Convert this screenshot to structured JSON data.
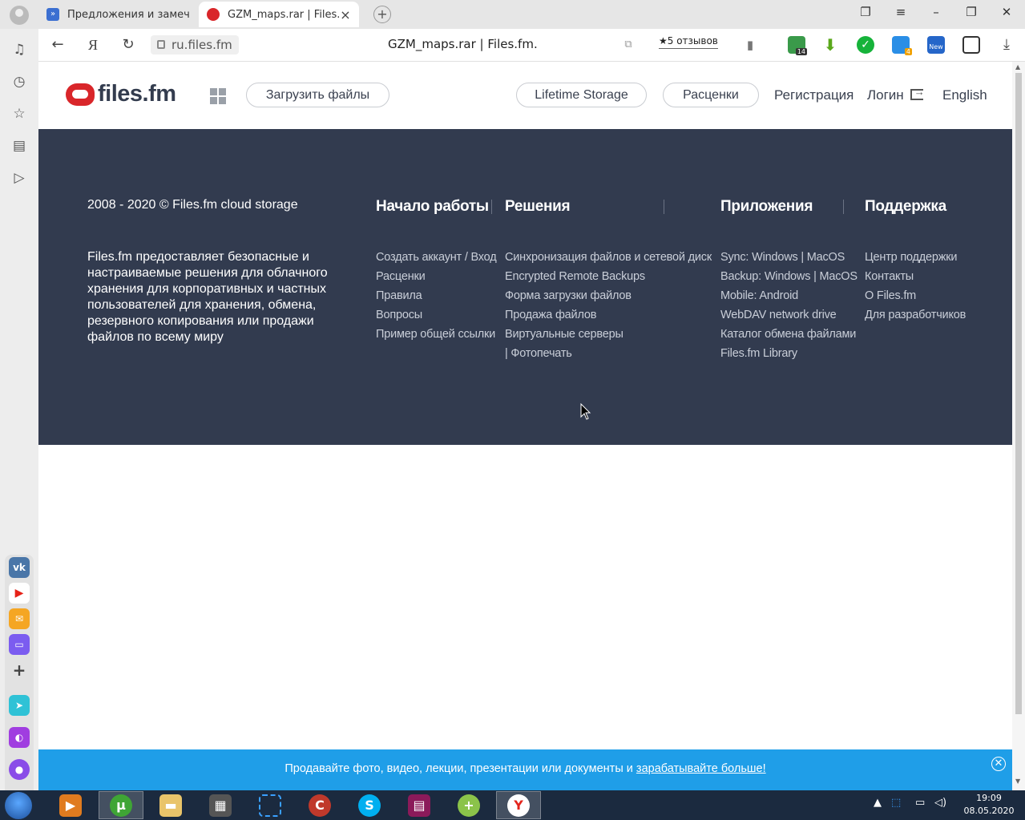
{
  "browser": {
    "tabs": [
      {
        "title": "Предложения и замечани"
      },
      {
        "title": "GZM_maps.rar | Files.fm"
      }
    ],
    "address": "ru.files.fm",
    "page_title": "GZM_maps.rar | Files.fm.",
    "reviews": "★5 отзывов",
    "ext_badges": {
      "mail": "14",
      "news": "4",
      "new": "New"
    }
  },
  "sidebar": {
    "icons": [
      "bell-icon",
      "history-icon",
      "star-icon",
      "collections-icon",
      "play-icon"
    ],
    "apps": [
      "vk-icon",
      "youtube-icon",
      "mail-icon",
      "alice-icon",
      "add-icon",
      "messenger-icon",
      "music-icon",
      "alice-assistant-icon"
    ]
  },
  "site": {
    "logo": "files.fm",
    "upload_label": "Загрузить файлы",
    "lifetime_label": "Lifetime Storage",
    "pricing_label": "Расценки",
    "register_label": "Регистрация",
    "login_label": "Логин",
    "lang_label": "English"
  },
  "footer": {
    "copyright": "2008 - 2020 © Files.fm cloud storage",
    "description": "Files.fm предоставляет безопасные и настраиваемые решения для облачного хранения для корпоративных и частных пользователей для хранения, обмена, резервного копирования или продажи файлов по всему миру",
    "columns": [
      {
        "heading": "Начало работы",
        "links": [
          "Создать аккаунт / Вход",
          "Расценки",
          "Правила",
          "Вопросы",
          "Пример общей ссылки"
        ]
      },
      {
        "heading": "Решения",
        "links": [
          "Синхронизация файлов и сетевой диск",
          "Encrypted Remote Backups",
          "Форма загрузки файлов",
          "Продажа файлов",
          "Виртуальные серверы",
          "| Фотопечать"
        ]
      },
      {
        "heading": "Приложения",
        "links": [
          "Sync: Windows | MacOS",
          "Backup: Windows | MacOS",
          "Mobile: Android",
          "WebDAV network drive",
          "Каталог обмена файлами",
          "Files.fm Library"
        ]
      },
      {
        "heading": "Поддержка",
        "links": [
          "Центр поддержки",
          "Контакты",
          "О Files.fm",
          "Для разработчиков"
        ]
      }
    ]
  },
  "promo": {
    "text": "Продавайте фото, видео, лекции, презентации или документы и ",
    "link": "зарабатывайте больше!",
    "close": "✕"
  },
  "taskbar": {
    "clock_time": "19:09",
    "clock_date": "08.05.2020"
  }
}
